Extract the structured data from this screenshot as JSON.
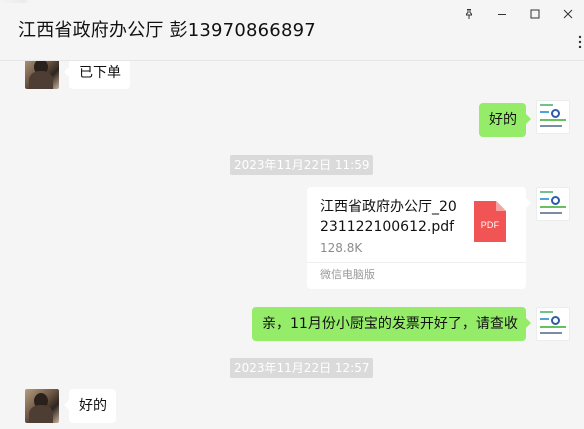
{
  "window": {
    "title": "江西省政府办公厅 彭13970866897",
    "controls": [
      "pin-icon",
      "minimize-icon",
      "maximize-icon",
      "close-icon"
    ],
    "more_icon": "more-icon"
  },
  "messages": [
    {
      "type": "text",
      "side": "left",
      "text": "已下单",
      "avatar_icon": "contact-avatar"
    },
    {
      "type": "text",
      "side": "right",
      "text": "好的",
      "avatar_icon": "self-avatar"
    },
    {
      "type": "timestamp",
      "text": "2023年11月22日 11:59"
    },
    {
      "type": "file",
      "side": "right",
      "file_name": "江西省政府办公厅_20231122100612.pdf",
      "file_size": "128.8K",
      "source": "微信电脑版",
      "file_icon": "pdf-file-icon",
      "file_icon_label": "PDF",
      "avatar_icon": "self-avatar"
    },
    {
      "type": "text",
      "side": "right",
      "text": "亲，11月份小厨宝的发票开好了，请查收",
      "avatar_icon": "self-avatar"
    },
    {
      "type": "timestamp",
      "text": "2023年11月22日 12:57"
    },
    {
      "type": "text",
      "side": "left",
      "text": "好的",
      "avatar_icon": "contact-avatar"
    }
  ],
  "colors": {
    "background": "#f5f5f5",
    "bubble_self": "#95ec69",
    "bubble_other": "#ffffff",
    "timestamp_bg": "#dadada",
    "pdf_red": "#f05454"
  }
}
